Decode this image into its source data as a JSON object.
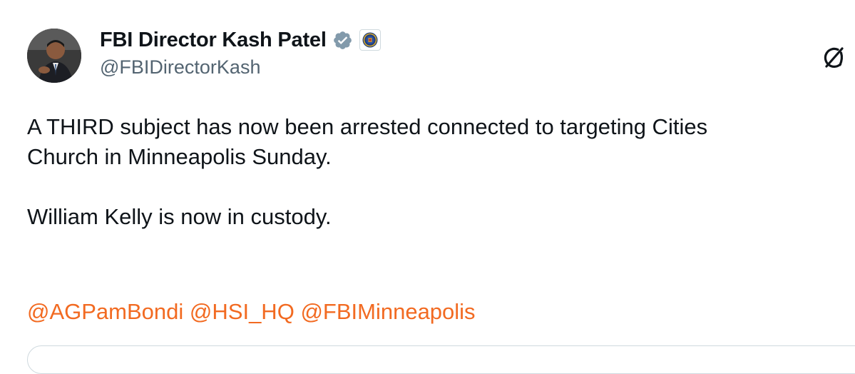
{
  "author": {
    "display_name": "FBI Director Kash Patel",
    "handle": "@FBIDirectorKash"
  },
  "tweet": {
    "line_1": "A THIRD subject has now been arrested connected to targeting Cities",
    "line_2": "Church in Minneapolis Sunday.",
    "line_3": "William Kelly is now in custody.",
    "mentions": [
      "@AGPamBondi",
      "@HSI_HQ",
      "@FBIMinneapolis"
    ]
  },
  "colors": {
    "verified_badge": "#829aab",
    "mention": "#f26a21",
    "handle": "#536471"
  },
  "icons": {
    "verified": "verified-badge-icon",
    "affiliate": "fbi-seal-icon",
    "grok": "grok-icon"
  }
}
